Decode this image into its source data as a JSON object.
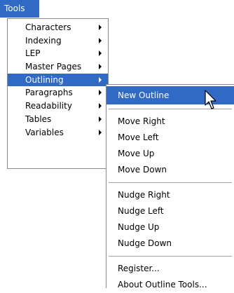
{
  "menubar": {
    "title": "Tools"
  },
  "tools_menu": {
    "items": [
      {
        "label": "Characters",
        "has_submenu": true
      },
      {
        "label": "Indexing",
        "has_submenu": true
      },
      {
        "label": "LEP",
        "has_submenu": true
      },
      {
        "label": "Master Pages",
        "has_submenu": true
      },
      {
        "label": "Outlining",
        "has_submenu": true,
        "active": true
      },
      {
        "label": "Paragraphs",
        "has_submenu": true
      },
      {
        "label": "Readability",
        "has_submenu": true
      },
      {
        "label": "Tables",
        "has_submenu": true
      },
      {
        "label": "Variables",
        "has_submenu": true
      }
    ]
  },
  "outlining_submenu": {
    "group1": [
      "New Outline"
    ],
    "group2": [
      "Move Right",
      "Move Left",
      "Move Up",
      "Move Down"
    ],
    "group3": [
      "Nudge Right",
      "Nudge Left",
      "Nudge Up",
      "Nudge Down"
    ],
    "group4": [
      "Register...",
      "About Outline Tools..."
    ]
  },
  "colors": {
    "highlight": "#316ac5",
    "border": "#8a8a8a"
  },
  "icons": {
    "cursor": "mouse-pointer-icon",
    "submenu_arrow": "chevron-right-icon"
  }
}
